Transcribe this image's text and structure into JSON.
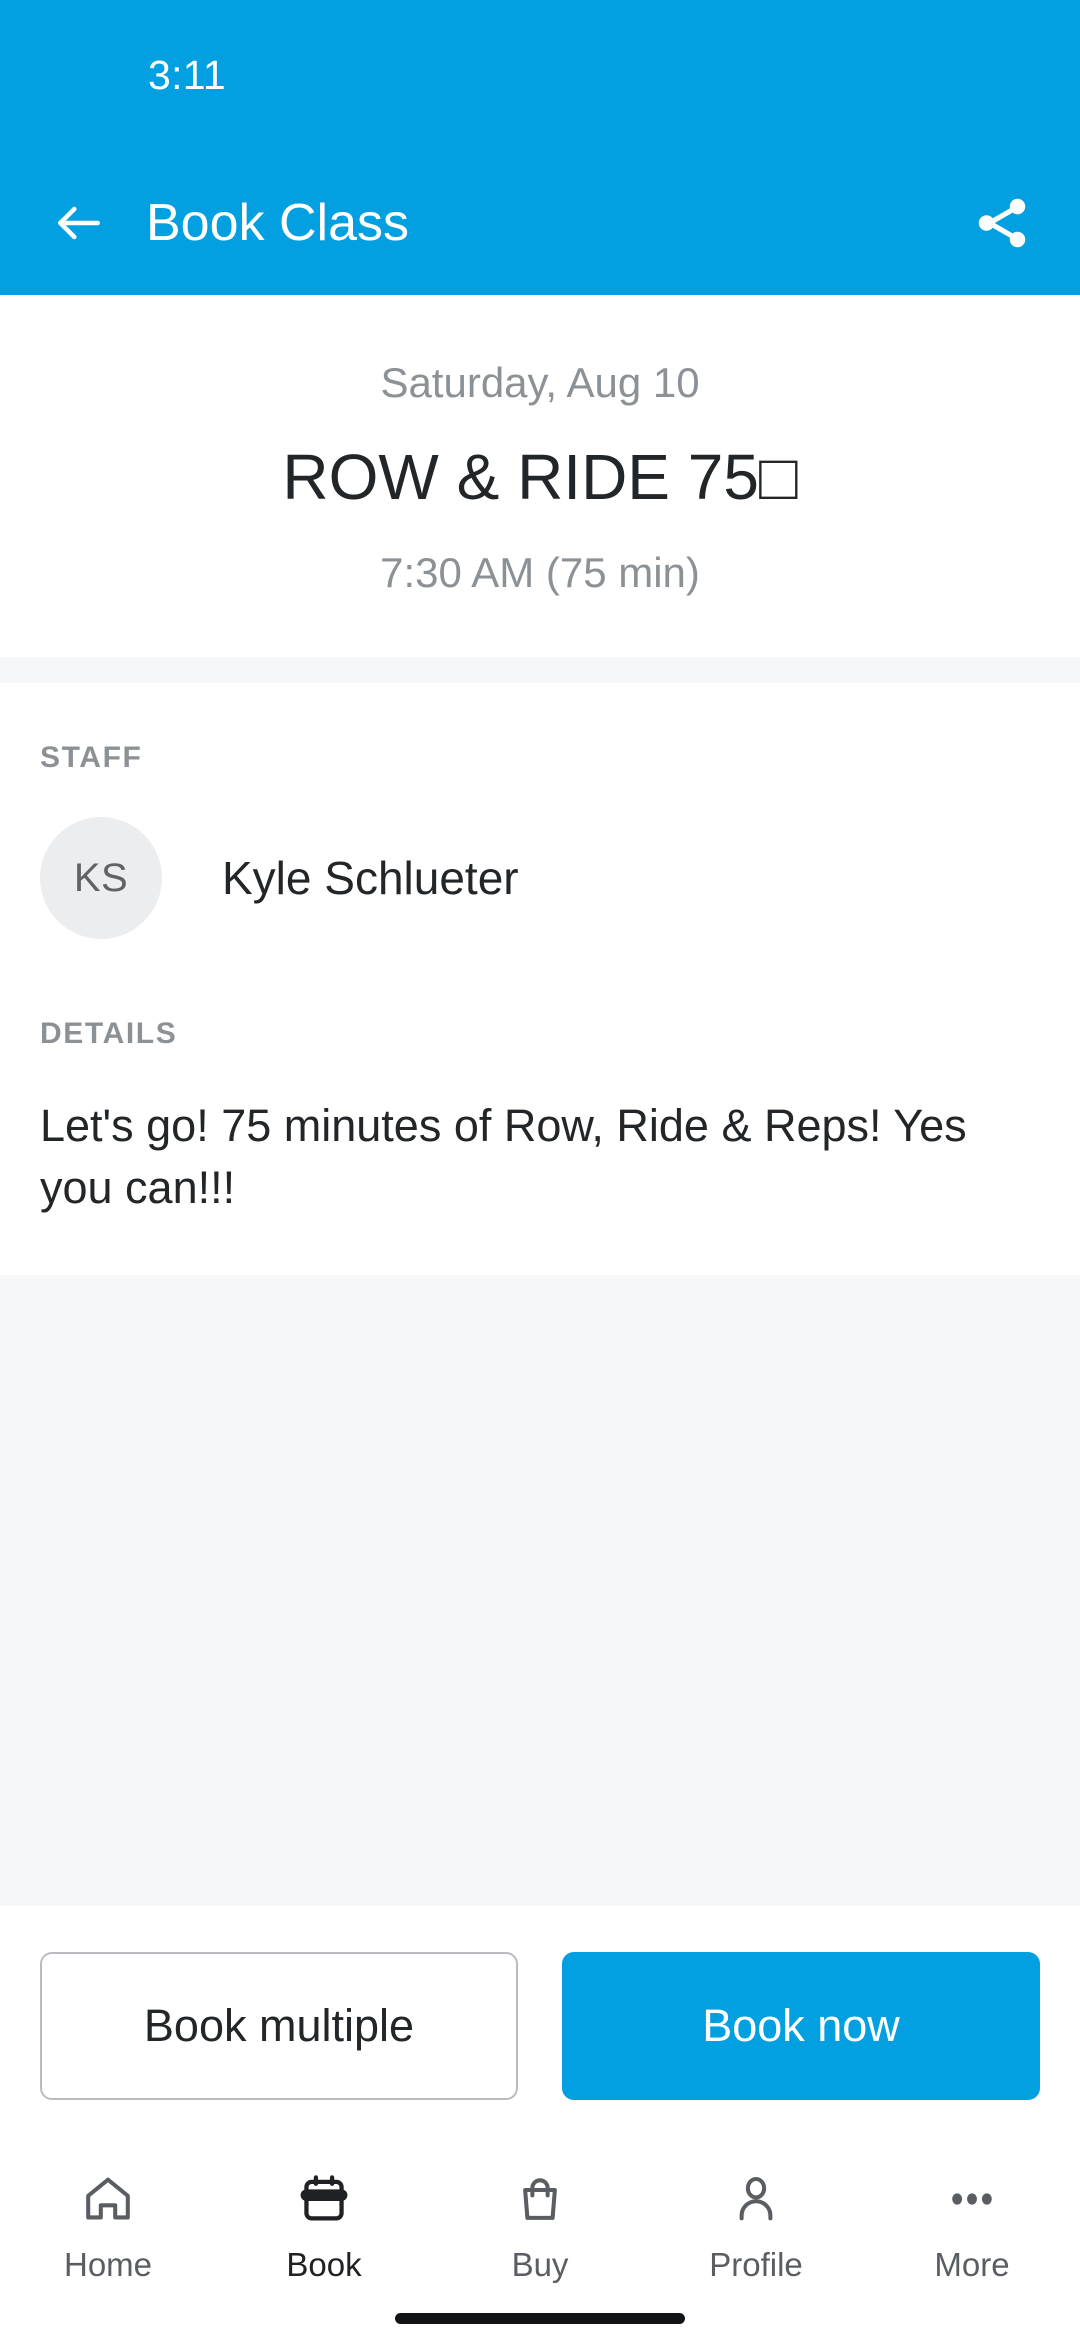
{
  "status_bar": {
    "time": "3:11"
  },
  "app_bar": {
    "title": "Book Class",
    "back_icon": "back-arrow-icon",
    "share_icon": "share-icon",
    "background_color": "#02A0E0",
    "text_color": "#FFFFFF"
  },
  "class": {
    "date": "Saturday, Aug 10",
    "name": "ROW & RIDE 75□",
    "time": "7:30 AM (75 min)"
  },
  "staff": {
    "section_label": "STAFF",
    "avatar_initials": "KS",
    "name": "Kyle Schlueter"
  },
  "details": {
    "section_label": "DETAILS",
    "body": "Let's go! 75 minutes of Row, Ride & Reps! Yes you can!!!"
  },
  "actions": {
    "secondary_label": "Book multiple",
    "primary_label": "Book now",
    "primary_color": "#02A0E0"
  },
  "bottom_nav": {
    "items": [
      {
        "label": "Home",
        "icon": "home-icon",
        "active": false
      },
      {
        "label": "Book",
        "icon": "calendar-icon",
        "active": true
      },
      {
        "label": "Buy",
        "icon": "shopping-bag-icon",
        "active": false
      },
      {
        "label": "Profile",
        "icon": "person-icon",
        "active": false
      },
      {
        "label": "More",
        "icon": "more-dots-icon",
        "active": false
      }
    ],
    "active_color": "#202124",
    "inactive_color": "#5A5E63"
  }
}
